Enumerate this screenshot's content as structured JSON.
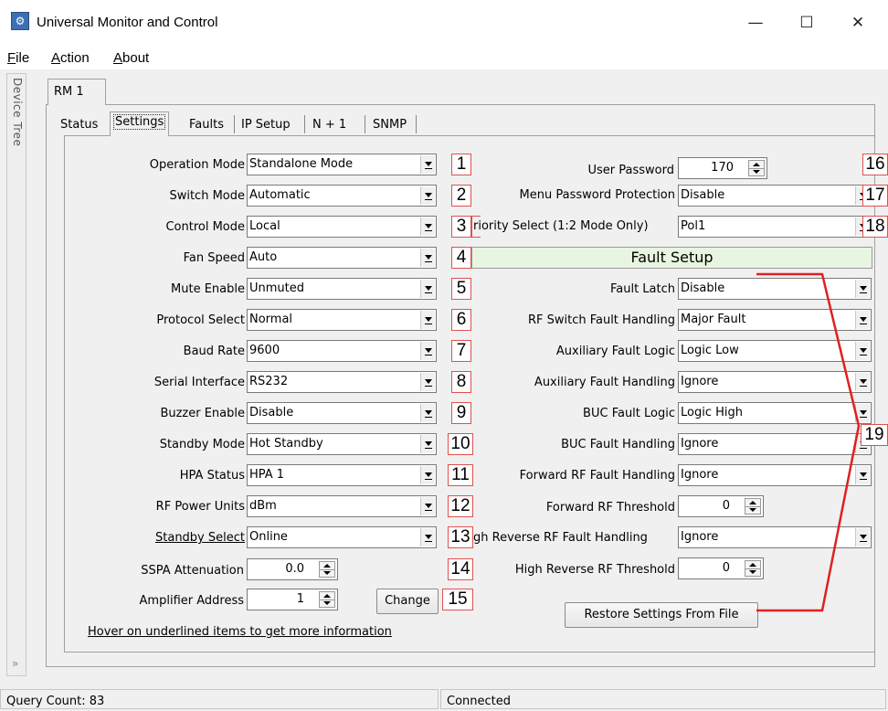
{
  "window": {
    "title": "Universal Monitor and Control",
    "minimize_glyph": "—",
    "maximize_glyph": "☐",
    "close_glyph": "✕"
  },
  "menu": [
    {
      "label": "File",
      "mnemonic": "F",
      "rest": "ile"
    },
    {
      "label": "Action",
      "mnemonic": "A",
      "rest": "ction"
    },
    {
      "label": "About",
      "mnemonic": "A",
      "rest": "bout"
    }
  ],
  "sidebar": {
    "label": "Device Tree",
    "expand_glyph": "»"
  },
  "device_tab": "RM 1",
  "tabs": [
    "Status",
    "Settings",
    "Faults",
    "IP Setup",
    "N + 1",
    "SNMP"
  ],
  "active_tab": "Settings",
  "left_fields": [
    {
      "label": "Operation Mode",
      "value": "Standalone Mode",
      "num": "1"
    },
    {
      "label": "Switch Mode",
      "value": "Automatic",
      "num": "2"
    },
    {
      "label": "Control Mode",
      "value": "Local",
      "num": "3"
    },
    {
      "label": "Fan Speed",
      "value": "Auto",
      "num": "4"
    },
    {
      "label": "Mute Enable",
      "value": "Unmuted",
      "num": "5"
    },
    {
      "label": "Protocol Select",
      "value": "Normal",
      "num": "6"
    },
    {
      "label": "Baud Rate",
      "value": "9600",
      "num": "7"
    },
    {
      "label": "Serial Interface",
      "value": "RS232",
      "num": "8"
    },
    {
      "label": "Buzzer Enable",
      "value": "Disable",
      "num": "9"
    },
    {
      "label": "Standby Mode",
      "value": "Hot Standby",
      "num": "10"
    },
    {
      "label": "HPA Status",
      "value": "HPA 1",
      "num": "11"
    },
    {
      "label": "RF Power Units",
      "value": "dBm",
      "num": "12"
    },
    {
      "label": "Standby Select",
      "value": "Online",
      "num": "13"
    }
  ],
  "sspa_attenuation": {
    "label": "SSPA Attenuation",
    "value": "0.0",
    "num": "14"
  },
  "amplifier_address": {
    "label": "Amplifier Address",
    "value": "1",
    "num": "15",
    "button": "Change"
  },
  "hover_note": "Hover on underlined items to get more information",
  "right_top": {
    "user_password": {
      "label": "User Password",
      "value": "170",
      "num": "16"
    },
    "menu_password": {
      "label": "Menu Password Protection",
      "value": "Disable",
      "num": "17"
    },
    "priority_select": {
      "label": "riority Select (1:2 Mode Only)",
      "value": "Pol1",
      "num": "18"
    }
  },
  "fault_setup": {
    "title": "Fault Setup",
    "num": "19",
    "fields": [
      {
        "label": "Fault Latch",
        "value": "Disable"
      },
      {
        "label": "RF Switch Fault Handling",
        "value": "Major Fault"
      },
      {
        "label": "Auxiliary Fault Logic",
        "value": "Logic Low"
      },
      {
        "label": "Auxiliary Fault Handling",
        "value": "Ignore"
      },
      {
        "label": "BUC Fault Logic",
        "value": "Logic High"
      },
      {
        "label": "BUC Fault Handling",
        "value": "Ignore"
      },
      {
        "label": "Forward RF Fault Handling",
        "value": "Ignore"
      }
    ],
    "forward_threshold": {
      "label": "Forward RF Threshold",
      "value": "0"
    },
    "reverse_handling": {
      "label": "gh Reverse RF Fault Handling",
      "value": "Ignore"
    },
    "reverse_threshold": {
      "label": "High Reverse RF Threshold",
      "value": "0"
    }
  },
  "restore_button": "Restore Settings From File",
  "status": {
    "query_count": "Query Count: 83",
    "connection": "Connected"
  },
  "colors": {
    "annotation": "#e02020",
    "fault_header_bg": "#e8f5e0"
  }
}
